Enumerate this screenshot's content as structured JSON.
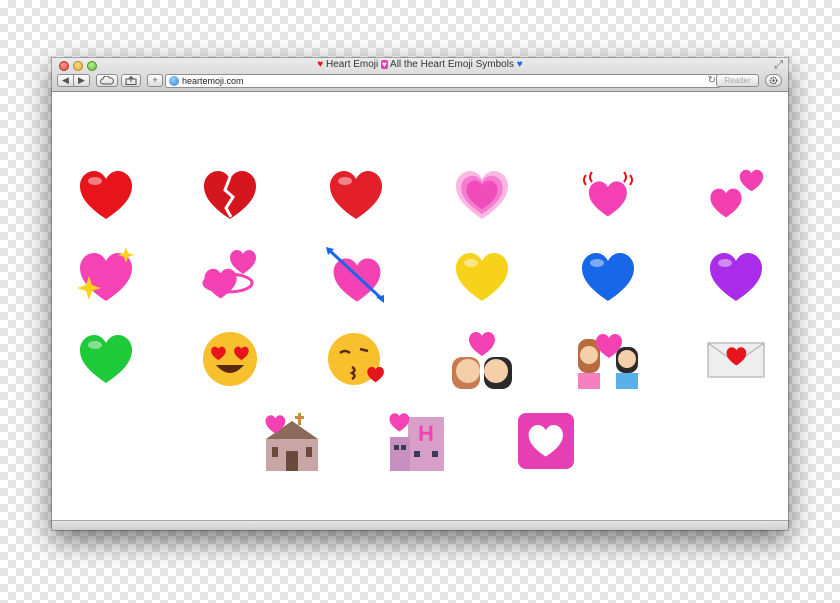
{
  "window": {
    "title": "Heart Emoji",
    "title_suffix": "All the Heart Emoji Symbols",
    "url": "heartemoji.com",
    "reader_label": "Reader",
    "reload_glyph": "↻"
  },
  "toolbar": {
    "back_glyph": "◀",
    "forward_glyph": "▶",
    "add_glyph": "+"
  },
  "emojis": [
    {
      "icon": "red-heart-icon",
      "color": "#e8141c"
    },
    {
      "icon": "broken-heart-icon",
      "color": "#d5161f"
    },
    {
      "icon": "red-heart-icon",
      "color": "#e3202a"
    },
    {
      "icon": "growing-heart-icon",
      "color": "#f04cba"
    },
    {
      "icon": "beating-heart-icon",
      "color": "#f53fb4"
    },
    {
      "icon": "two-hearts-icon",
      "color": "#f43fb1"
    },
    {
      "icon": "sparkling-heart-icon",
      "color": "#f542b5"
    },
    {
      "icon": "revolving-hearts-icon",
      "color": "#f442b4"
    },
    {
      "icon": "heart-with-arrow-icon",
      "color": "#f442b4"
    },
    {
      "icon": "yellow-heart-icon",
      "color": "#f7d21a"
    },
    {
      "icon": "blue-heart-icon",
      "color": "#1767e8"
    },
    {
      "icon": "purple-heart-icon",
      "color": "#a92cea"
    },
    {
      "icon": "green-heart-icon",
      "color": "#1ec93a"
    },
    {
      "icon": "heart-eyes-face-icon",
      "color": "#f7c02c"
    },
    {
      "icon": "kissing-face-heart-icon",
      "color": "#f7c02c"
    },
    {
      "icon": "couple-kiss-icon",
      "color": "#f442b4"
    },
    {
      "icon": "couple-with-heart-icon",
      "color": "#f442b4"
    },
    {
      "icon": "love-letter-icon",
      "color": "#e8141c"
    },
    {
      "icon": "wedding-chapel-icon",
      "color": "#c9a6a6"
    },
    {
      "icon": "love-hotel-icon",
      "color": "#d8a0c8"
    },
    {
      "icon": "heart-decoration-icon",
      "color": "#e63fb4"
    }
  ]
}
